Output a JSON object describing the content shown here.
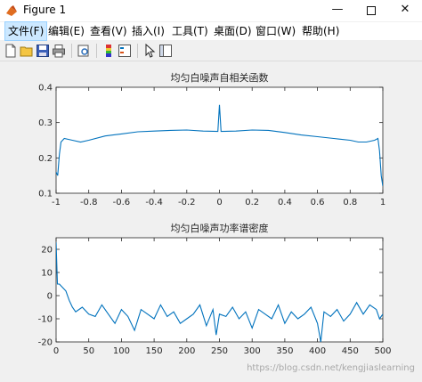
{
  "window": {
    "title": "Figure 1"
  },
  "menus": [
    "文件(F)",
    "编辑(E)",
    "查看(V)",
    "插入(I)",
    "工具(T)",
    "桌面(D)",
    "窗口(W)",
    "帮助(H)"
  ],
  "toolbar": {
    "icons": [
      "new-figure-icon",
      "open-file-icon",
      "save-icon",
      "print-icon",
      "print-preview-icon",
      "colorbar-icon",
      "legend-icon",
      "edit-plot-arrow-icon",
      "property-editor-icon"
    ]
  },
  "watermark": "https://blog.csdn.net/kengjiaslearning",
  "chart_data": [
    {
      "type": "line",
      "title": "均匀白噪声自相关函数",
      "xlabel": "",
      "ylabel": "",
      "xlim": [
        -1,
        1
      ],
      "ylim": [
        0.1,
        0.4
      ],
      "xticks": [
        "-1",
        "-0.8",
        "-0.6",
        "-0.4",
        "-0.2",
        "0",
        "0.2",
        "0.4",
        "0.6",
        "0.8",
        "1"
      ],
      "yticks": [
        "0.1",
        "0.2",
        "0.3",
        "0.4"
      ],
      "x": [
        -1,
        -0.99,
        -0.98,
        -0.97,
        -0.95,
        -0.9,
        -0.85,
        -0.8,
        -0.7,
        -0.6,
        -0.5,
        -0.4,
        -0.3,
        -0.2,
        -0.1,
        -0.01,
        0,
        0.01,
        0.1,
        0.2,
        0.3,
        0.4,
        0.5,
        0.6,
        0.7,
        0.8,
        0.85,
        0.9,
        0.95,
        0.97,
        0.98,
        0.99,
        1
      ],
      "y": [
        0.16,
        0.15,
        0.21,
        0.245,
        0.255,
        0.25,
        0.245,
        0.25,
        0.262,
        0.268,
        0.274,
        0.276,
        0.278,
        0.279,
        0.276,
        0.275,
        0.35,
        0.275,
        0.276,
        0.279,
        0.278,
        0.272,
        0.265,
        0.26,
        0.255,
        0.25,
        0.245,
        0.245,
        0.25,
        0.255,
        0.22,
        0.15,
        0.12
      ],
      "color": "#0072bd"
    },
    {
      "type": "line",
      "title": "均匀白噪声功率谱密度",
      "xlabel": "",
      "ylabel": "",
      "xlim": [
        0,
        500
      ],
      "ylim": [
        -20,
        25
      ],
      "xticks": [
        "0",
        "50",
        "100",
        "150",
        "200",
        "250",
        "300",
        "350",
        "400",
        "450",
        "500"
      ],
      "yticks": [
        "-20",
        "-10",
        "0",
        "10",
        "20"
      ],
      "x": [
        0,
        2,
        5,
        10,
        15,
        20,
        25,
        30,
        40,
        50,
        60,
        70,
        80,
        90,
        100,
        110,
        120,
        130,
        140,
        150,
        160,
        170,
        180,
        190,
        200,
        210,
        220,
        230,
        240,
        245,
        250,
        260,
        270,
        280,
        290,
        300,
        310,
        320,
        330,
        340,
        350,
        360,
        370,
        380,
        390,
        400,
        405,
        410,
        420,
        430,
        440,
        450,
        460,
        470,
        480,
        490,
        495,
        500
      ],
      "y": [
        23,
        5,
        5,
        3.5,
        2,
        -2,
        -5,
        -7,
        -5,
        -8,
        -9,
        -4,
        -8,
        -12,
        -6,
        -9,
        -15,
        -6,
        -8,
        -10,
        -4,
        -9,
        -7,
        -12,
        -10,
        -8,
        -4,
        -13,
        -6,
        -17,
        -8,
        -9,
        -5,
        -10,
        -7,
        -14,
        -6,
        -8,
        -10,
        -4,
        -12,
        -7,
        -10,
        -8,
        -5,
        -12,
        -20,
        -7,
        -9,
        -6,
        -11,
        -8,
        -3,
        -8,
        -4,
        -6,
        -10,
        -8
      ],
      "color": "#0072bd"
    }
  ]
}
